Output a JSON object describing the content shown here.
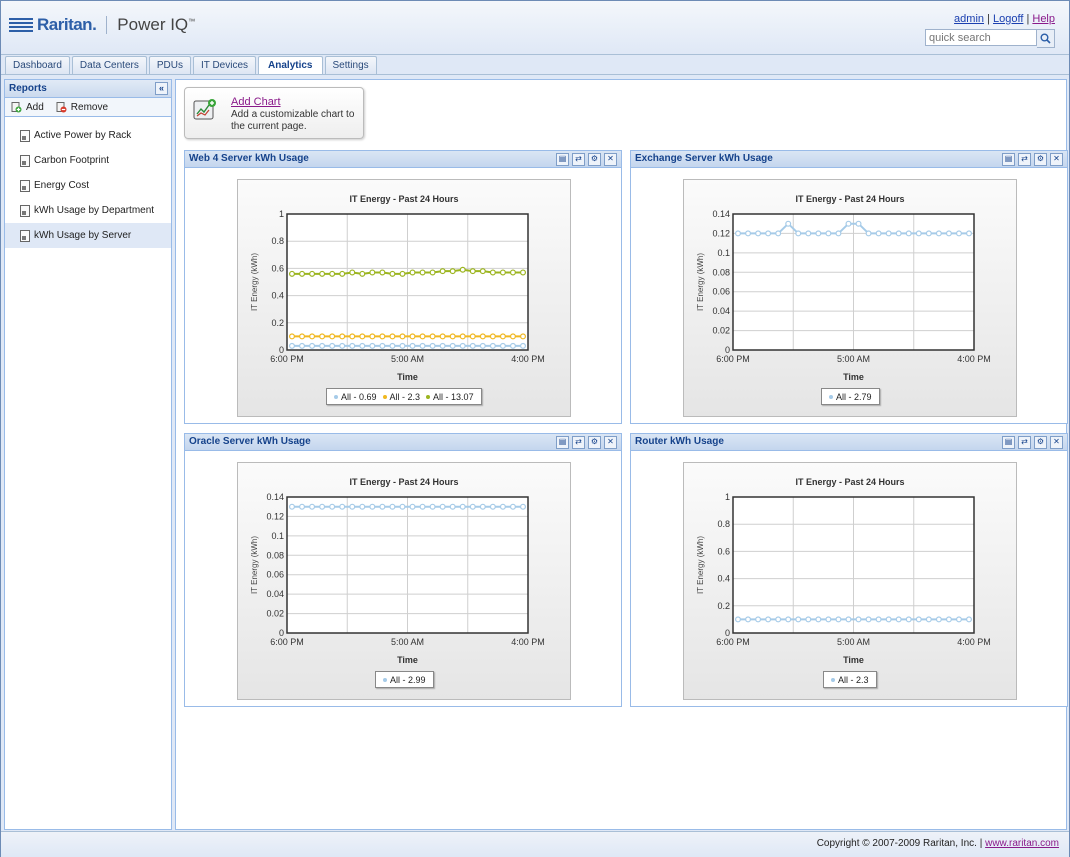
{
  "header": {
    "brand": "Raritan.",
    "product": "Power IQ",
    "product_tm": "™",
    "links": {
      "admin": "admin",
      "logoff": "Logoff",
      "help": "Help",
      "sep": "|"
    },
    "search_placeholder": "quick search"
  },
  "tabs": [
    {
      "label": "Dashboard",
      "active": false
    },
    {
      "label": "Data Centers",
      "active": false
    },
    {
      "label": "PDUs",
      "active": false
    },
    {
      "label": "IT Devices",
      "active": false
    },
    {
      "label": "Analytics",
      "active": true
    },
    {
      "label": "Settings",
      "active": false
    }
  ],
  "sidebar": {
    "title": "Reports",
    "collapse_glyph": "«",
    "add_label": "Add",
    "remove_label": "Remove",
    "items": [
      {
        "label": "Active Power by Rack",
        "selected": false
      },
      {
        "label": "Carbon Footprint",
        "selected": false
      },
      {
        "label": "Energy Cost",
        "selected": false
      },
      {
        "label": "kWh Usage by Department",
        "selected": false
      },
      {
        "label": "kWh Usage by Server",
        "selected": true
      }
    ]
  },
  "add_chart": {
    "link": "Add Chart",
    "description": "Add a customizable chart to the current page."
  },
  "colors": {
    "accent": "#15428b",
    "series_blue": "#a6cbe8",
    "series_orange": "#f0b820",
    "series_green": "#9cb520"
  },
  "chart_data": [
    {
      "panel_title": "Web 4 Server kWh Usage",
      "type": "line",
      "title": "IT Energy - Past 24 Hours",
      "xlabel": "Time",
      "ylabel": "IT Energy (kWh)",
      "x_ticks": [
        "6:00 PM",
        "5:00 AM",
        "4:00 PM"
      ],
      "y_ticks": [
        "0",
        "0.2",
        "0.4",
        "0.6",
        "0.8",
        "1"
      ],
      "ylim": [
        0,
        1
      ],
      "grid": true,
      "series": [
        {
          "name": "All - 0.69",
          "color": "#a6cbe8",
          "values": [
            0.03,
            0.03,
            0.03,
            0.03,
            0.03,
            0.03,
            0.03,
            0.03,
            0.03,
            0.03,
            0.03,
            0.03,
            0.03,
            0.03,
            0.03,
            0.03,
            0.03,
            0.03,
            0.03,
            0.03,
            0.03,
            0.03,
            0.03,
            0.03
          ]
        },
        {
          "name": "All - 2.3",
          "color": "#f0b820",
          "values": [
            0.1,
            0.1,
            0.1,
            0.1,
            0.1,
            0.1,
            0.1,
            0.1,
            0.1,
            0.1,
            0.1,
            0.1,
            0.1,
            0.1,
            0.1,
            0.1,
            0.1,
            0.1,
            0.1,
            0.1,
            0.1,
            0.1,
            0.1,
            0.1
          ]
        },
        {
          "name": "All - 13.07",
          "color": "#9cb520",
          "values": [
            0.56,
            0.56,
            0.56,
            0.56,
            0.56,
            0.56,
            0.57,
            0.56,
            0.57,
            0.57,
            0.56,
            0.56,
            0.57,
            0.57,
            0.57,
            0.58,
            0.58,
            0.59,
            0.58,
            0.58,
            0.57,
            0.57,
            0.57,
            0.57
          ]
        }
      ]
    },
    {
      "panel_title": "Exchange Server kWh Usage",
      "type": "line",
      "title": "IT Energy - Past 24 Hours",
      "xlabel": "Time",
      "ylabel": "IT Energy (kWh)",
      "x_ticks": [
        "6:00 PM",
        "5:00 AM",
        "4:00 PM"
      ],
      "y_ticks": [
        "0",
        "0.02",
        "0.04",
        "0.06",
        "0.08",
        "0.1",
        "0.12",
        "0.14"
      ],
      "ylim": [
        0,
        0.14
      ],
      "grid": true,
      "series": [
        {
          "name": "All - 2.79",
          "color": "#a6cbe8",
          "values": [
            0.12,
            0.12,
            0.12,
            0.12,
            0.12,
            0.13,
            0.12,
            0.12,
            0.12,
            0.12,
            0.12,
            0.13,
            0.13,
            0.12,
            0.12,
            0.12,
            0.12,
            0.12,
            0.12,
            0.12,
            0.12,
            0.12,
            0.12,
            0.12
          ]
        }
      ]
    },
    {
      "panel_title": "Oracle Server kWh Usage",
      "type": "line",
      "title": "IT Energy - Past 24 Hours",
      "xlabel": "Time",
      "ylabel": "IT Energy (kWh)",
      "x_ticks": [
        "6:00 PM",
        "5:00 AM",
        "4:00 PM"
      ],
      "y_ticks": [
        "0",
        "0.02",
        "0.04",
        "0.06",
        "0.08",
        "0.1",
        "0.12",
        "0.14"
      ],
      "ylim": [
        0,
        0.14
      ],
      "grid": true,
      "series": [
        {
          "name": "All - 2.99",
          "color": "#a6cbe8",
          "values": [
            0.13,
            0.13,
            0.13,
            0.13,
            0.13,
            0.13,
            0.13,
            0.13,
            0.13,
            0.13,
            0.13,
            0.13,
            0.13,
            0.13,
            0.13,
            0.13,
            0.13,
            0.13,
            0.13,
            0.13,
            0.13,
            0.13,
            0.13,
            0.13
          ]
        }
      ]
    },
    {
      "panel_title": "Router kWh Usage",
      "type": "line",
      "title": "IT Energy - Past 24 Hours",
      "xlabel": "Time",
      "ylabel": "IT Energy (kWh)",
      "x_ticks": [
        "6:00 PM",
        "5:00 AM",
        "4:00 PM"
      ],
      "y_ticks": [
        "0",
        "0.2",
        "0.4",
        "0.6",
        "0.8",
        "1"
      ],
      "ylim": [
        0,
        1
      ],
      "grid": true,
      "series": [
        {
          "name": "All - 2.3",
          "color": "#a6cbe8",
          "values": [
            0.1,
            0.1,
            0.1,
            0.1,
            0.1,
            0.1,
            0.1,
            0.1,
            0.1,
            0.1,
            0.1,
            0.1,
            0.1,
            0.1,
            0.1,
            0.1,
            0.1,
            0.1,
            0.1,
            0.1,
            0.1,
            0.1,
            0.1,
            0.1
          ]
        }
      ]
    }
  ],
  "footer": {
    "copyright": "Copyright © 2007-2009 Raritan, Inc.",
    "sep": "|",
    "link": "www.raritan.com"
  }
}
